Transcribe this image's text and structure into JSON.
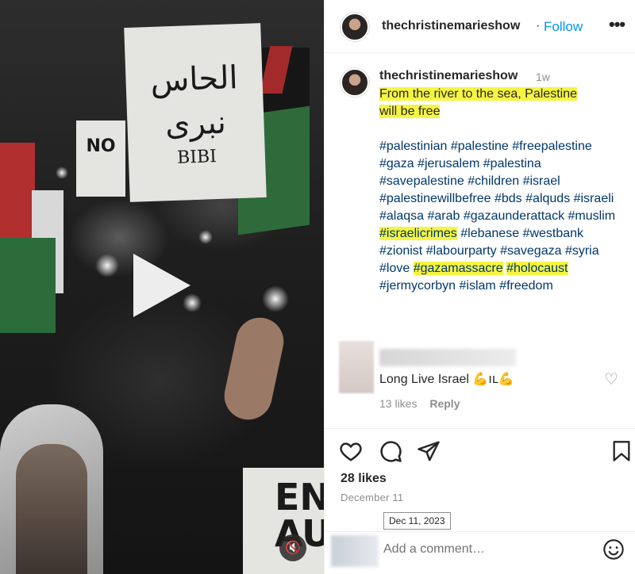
{
  "header": {
    "username": "thechristinemarieshow",
    "separator": "·",
    "follow_label": "Follow",
    "more_label": "•••"
  },
  "video": {
    "sign_arabic_line1": "الحاس",
    "sign_arabic_line2": "نبرى",
    "sign_arabic_line3": "BIBI",
    "sign_no": "NO",
    "sign_bottom_line1": "EN",
    "sign_bottom_line2": "AU",
    "mute_icon": "speaker-muted-icon",
    "play_icon": "play-icon"
  },
  "caption": {
    "username": "thechristinemarieshow",
    "time": "1w",
    "text_line1": "From the river to the sea, Palestine",
    "text_line2": "will be free"
  },
  "hashtags": [
    "#palestinian",
    "#palestine",
    "#freepalestine",
    "#gaza",
    "#jerusalem",
    "#palestina",
    "#savepalestine",
    "#children",
    "#israel",
    "#palestinewillbefree",
    "#bds",
    "#alquds",
    "#israeli",
    "#alaqsa",
    "#arab",
    "#gazaunderattack",
    "#muslim",
    "#israelicrimes",
    "#lebanese",
    "#westbank",
    "#zionist",
    "#labourparty",
    "#savegaza",
    "#syria",
    "#love",
    "#gazamassacre",
    "#holocaust",
    "#jermycorbyn",
    "#islam",
    "#freedom"
  ],
  "highlighted_hashtags": [
    "#israelicrimes",
    "#gazamassacre",
    "#holocaust"
  ],
  "comment": {
    "text": "Long Live Israel",
    "emoji": "💪ıʟ💪",
    "likes": "13 likes",
    "reply_label": "Reply"
  },
  "actions": {
    "likes_count": "28 likes",
    "date": "December 11",
    "date_tooltip": "Dec 11, 2023"
  },
  "add_comment": {
    "placeholder": "Add a comment…"
  },
  "colors": {
    "highlight": "#f5f542",
    "hashtag": "#00376b",
    "follow": "#0095f6",
    "muted_text": "#8e8e8e"
  }
}
